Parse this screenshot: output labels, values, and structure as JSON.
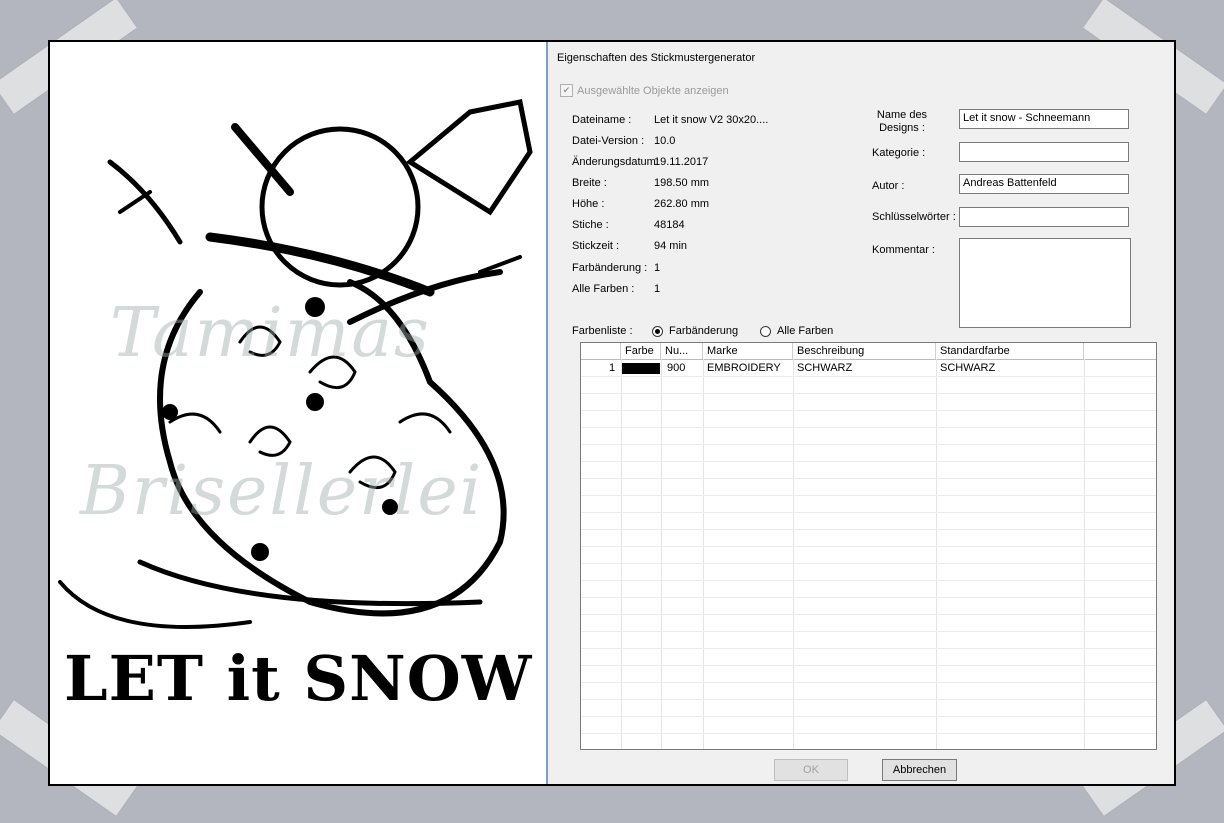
{
  "dialog": {
    "title": "Eigenschaften des Stickmustergenerator",
    "show_selected_label": "Ausgewählte Objekte anzeigen",
    "info_labels": {
      "filename": "Dateiname :",
      "version": "Datei-Version :",
      "modified": "Änderungsdatum:",
      "width": "Breite :",
      "height": "Höhe :",
      "stitches": "Stiche :",
      "stitch_time": "Stickzeit :",
      "color_changes": "Farbänderung :",
      "all_colors": "Alle Farben :"
    },
    "info_values": {
      "filename": "Let it snow V2 30x20....",
      "version": "10.0",
      "modified": "19.11.2017",
      "width": "198.50 mm",
      "height": "262.80 mm",
      "stitches": "48184",
      "stitch_time": "94 min",
      "color_changes": "1",
      "all_colors": "1"
    },
    "design_labels": {
      "name": "Name des Designs :",
      "category": "Kategorie :",
      "author": "Autor :",
      "keywords": "Schlüsselwörter :",
      "comment": "Kommentar :"
    },
    "design_values": {
      "name": "Let it snow - Schneemann",
      "category": "",
      "author": "Andreas Battenfeld",
      "keywords": "",
      "comment": ""
    },
    "colorlist_label": "Farbenliste :",
    "radio_color_change": "Farbänderung",
    "radio_all_colors": "Alle Farben",
    "table": {
      "headers": [
        "",
        "Farbe",
        "Nu...",
        "Marke",
        "Beschreibung",
        "Standardfarbe"
      ],
      "rows": [
        {
          "index": "1",
          "color": "#000000",
          "number": "900",
          "brand": "EMBROIDERY",
          "description": "SCHWARZ",
          "standard": "SCHWARZ"
        }
      ]
    },
    "ok_label": "OK",
    "cancel_label": "Abbrechen"
  },
  "preview": {
    "title_text": "LET it SNOW",
    "watermark_line1": "Tamimas",
    "watermark_line2": "Brisellerlei"
  },
  "colors": {
    "background": "#b3b6bf",
    "dialog_bg": "#f0f0f0",
    "accent_line": "#7a9fc9"
  }
}
